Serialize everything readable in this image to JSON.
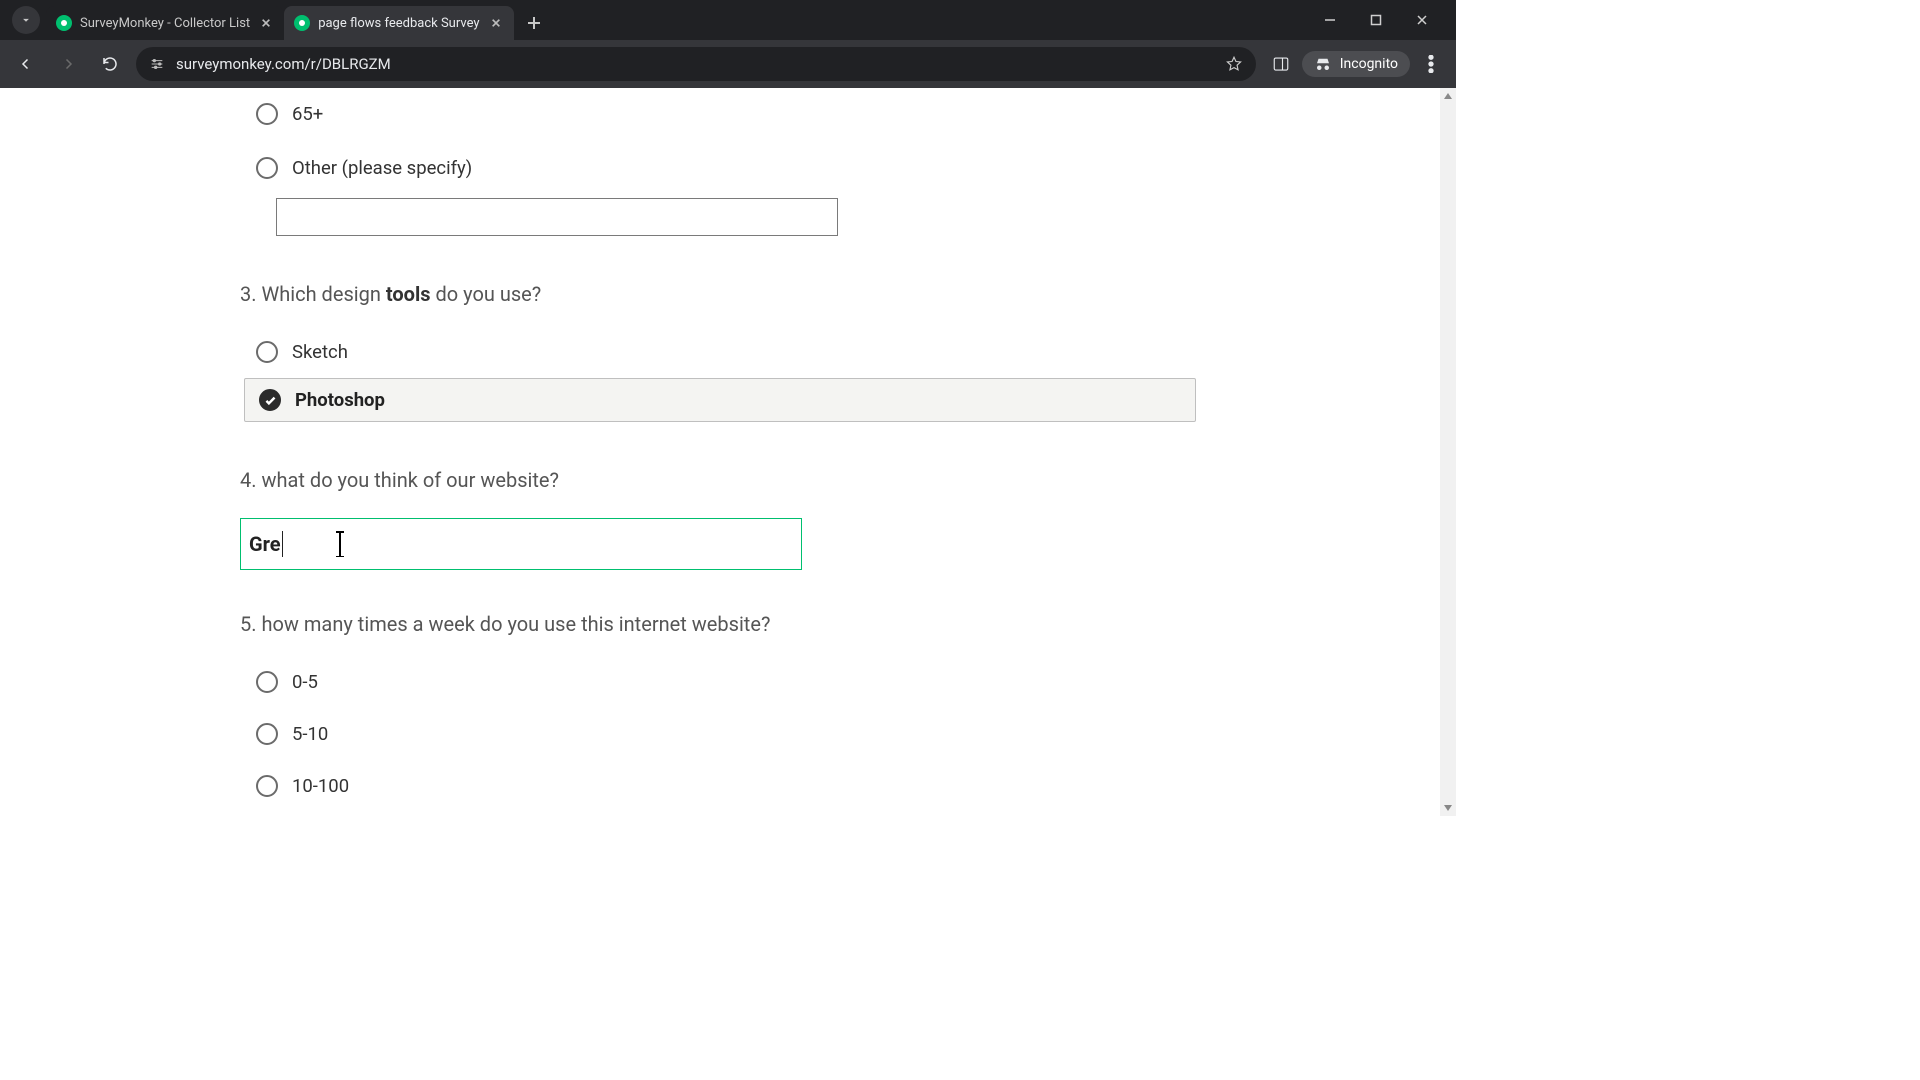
{
  "browser": {
    "tabs": [
      {
        "title": "SurveyMonkey - Collector List",
        "active": false
      },
      {
        "title": "page flows feedback Survey",
        "active": true
      }
    ],
    "url": "surveymonkey.com/r/DBLRGZM",
    "incognito_label": "Incognito"
  },
  "survey": {
    "q2_tail_options": [
      "65+",
      "Other (please specify)"
    ],
    "q2_other_value": "",
    "q3": {
      "number": "3.",
      "prefix": "Which design ",
      "bold": "tools",
      "suffix": " do you use?",
      "options": [
        {
          "label": "Sketch",
          "selected": false
        },
        {
          "label": "Photoshop",
          "selected": true
        }
      ]
    },
    "q4": {
      "number": "4.",
      "text": "what do you think of our website?",
      "value": "Gre"
    },
    "q5": {
      "number": "5.",
      "text": "how many times a week do you use this internet website?",
      "options": [
        "0-5",
        "5-10",
        "10-100"
      ]
    }
  }
}
